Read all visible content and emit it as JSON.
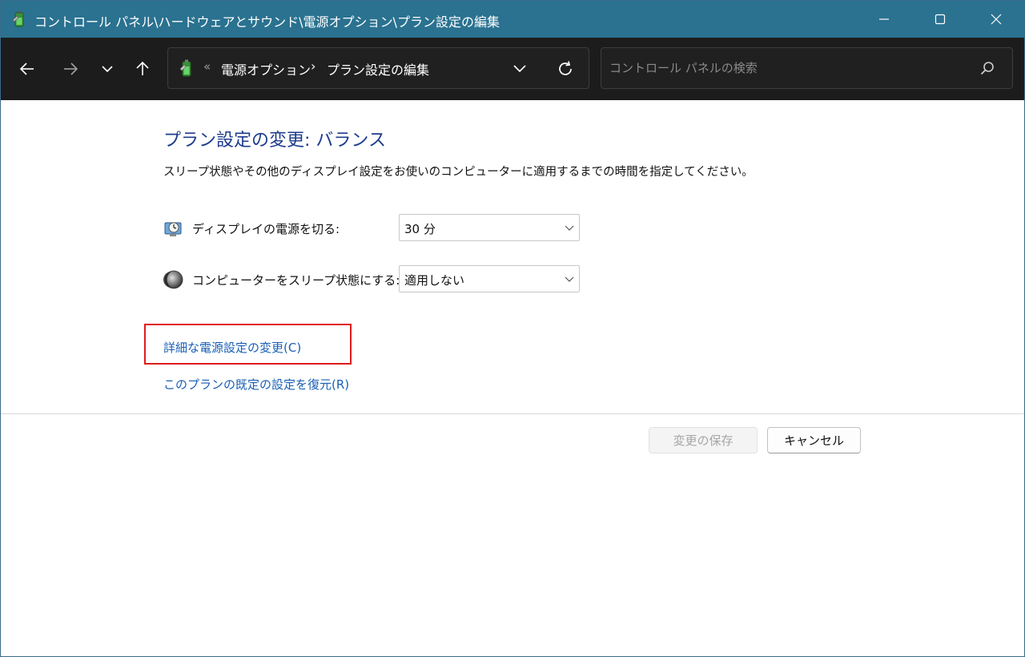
{
  "window": {
    "title": "コントロール パネル\\ハードウェアとサウンド\\電源オプション\\プラン設定の編集",
    "icons": {
      "app": "power-options-icon",
      "minimize": "minimize-icon",
      "maximize": "maximize-icon",
      "close": "close-icon"
    }
  },
  "navigation": {
    "icons": {
      "back": "arrow-left-icon",
      "forward": "arrow-right-icon",
      "recent": "chevron-down-icon",
      "up": "arrow-up-icon"
    },
    "address": {
      "overflow": "«",
      "crumbs": [
        "電源オプション",
        "プラン設定の編集"
      ],
      "separator": "›",
      "icons": {
        "location": "power-options-icon",
        "dropdown": "chevron-down-icon",
        "refresh": "refresh-icon"
      }
    },
    "search": {
      "placeholder": "コントロール パネルの検索",
      "value": "",
      "icon": "search-icon"
    }
  },
  "content": {
    "heading": "プラン設定の変更: バランス",
    "description": "スリープ状態やその他のディスプレイ設定をお使いのコンピューターに適用するまでの時間を指定してください。",
    "settings": {
      "display": {
        "label": "ディスプレイの電源を切る:",
        "value": "30 分",
        "icon": "monitor-clock-icon"
      },
      "sleep": {
        "label": "コンピューターをスリープ状態にする:",
        "value": "適用しない",
        "icon": "moon-icon"
      }
    },
    "links": {
      "advanced": "詳細な電源設定の変更(C)",
      "restore": "このプランの既定の設定を復元(R)"
    },
    "buttons": {
      "save": "変更の保存",
      "cancel": "キャンセル"
    },
    "highlight_color": "#e01b1b",
    "link_color": "#1a5fb4",
    "heading_color": "#1e3c8c"
  },
  "colors": {
    "titlebar": "#2a7290",
    "navbar": "#1c1c1c"
  }
}
